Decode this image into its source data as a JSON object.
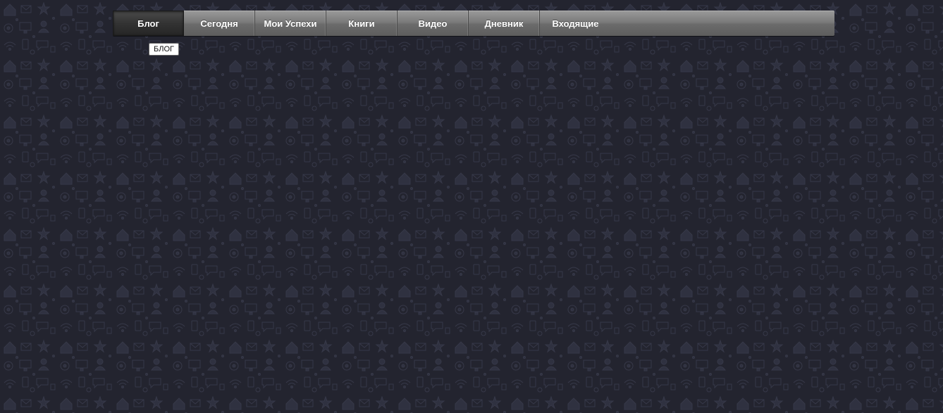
{
  "colors": {
    "page_background": "#23242f",
    "pattern_icons": "#30323f",
    "navbar_gradient_top": "#9a9a9a",
    "navbar_gradient_bottom": "#5d5d5d",
    "active_tab": "#333333",
    "tab_text": "#ffffff"
  },
  "background_pattern_icons": [
    "house-icon",
    "envelope-icon",
    "wifi-icon",
    "phone-icon",
    "star-icon",
    "gear-icon",
    "person-icon",
    "monitor-icon",
    "cloud-icon",
    "lock-icon",
    "chat-icon"
  ],
  "nav": {
    "items": [
      {
        "label": "Блог",
        "active": true
      },
      {
        "label": "Сегодня",
        "active": false
      },
      {
        "label": "Мои Успехи",
        "active": false
      },
      {
        "label": "Книги",
        "active": false
      },
      {
        "label": "Видео",
        "active": false
      },
      {
        "label": "Дневник",
        "active": false
      },
      {
        "label": "Входящие",
        "active": false
      }
    ]
  },
  "tooltip": {
    "text": "БЛОГ"
  }
}
